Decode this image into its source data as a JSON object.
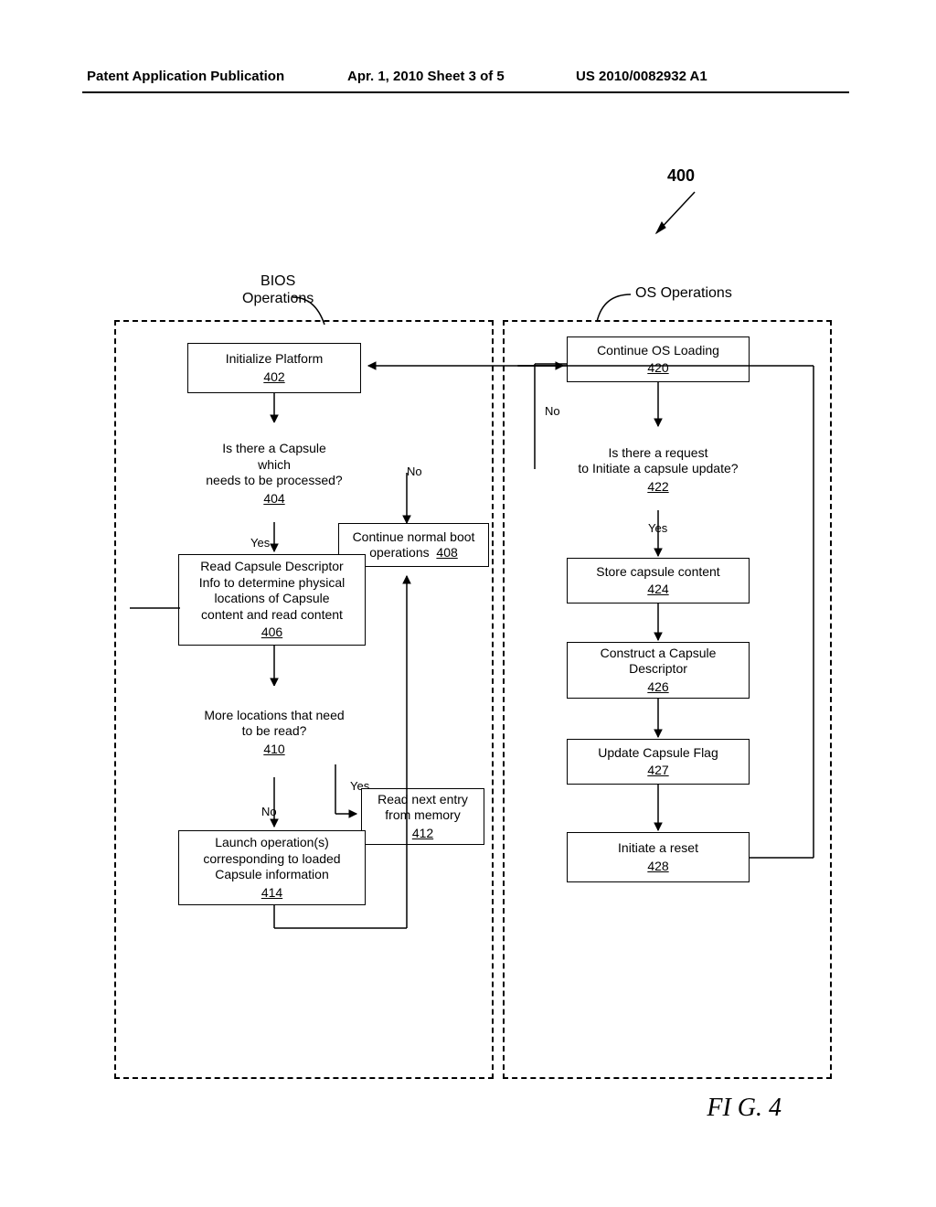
{
  "header": {
    "left": "Patent Application Publication",
    "center": "Apr. 1, 2010  Sheet 3 of 5",
    "right": "US 2010/0082932 A1"
  },
  "fig_number": "400",
  "bios_label_line1": "BIOS",
  "bios_label_line2": "Operations",
  "os_label": "OS Operations",
  "nodes": {
    "b402": {
      "text": "Initialize Platform",
      "ref": "402"
    },
    "b404": {
      "line1": "Is there a Capsule",
      "line2": "which",
      "line3": "needs to be processed?",
      "ref": "404"
    },
    "b406": {
      "line1": "Read Capsule Descriptor",
      "line2": "Info to determine physical",
      "line3": "locations of Capsule",
      "line4": "content and read content",
      "ref": "406"
    },
    "b408": {
      "line1": "Continue normal boot",
      "line2": "operations",
      "ref": "408"
    },
    "b410": {
      "line1": "More locations that need",
      "line2": "to be read?",
      "ref": "410"
    },
    "b412": {
      "line1": "Read next entry",
      "line2": "from memory",
      "ref": "412"
    },
    "b414": {
      "line1": "Launch operation(s)",
      "line2": "corresponding to loaded",
      "line3": "Capsule information",
      "ref": "414"
    },
    "b420": {
      "text": "Continue OS Loading",
      "ref": "420"
    },
    "b422": {
      "line1": "Is there a request",
      "line2": "to Initiate a capsule update?",
      "ref": "422"
    },
    "b424": {
      "text": "Store capsule content",
      "ref": "424"
    },
    "b426": {
      "line1": "Construct a Capsule",
      "line2": "Descriptor",
      "ref": "426"
    },
    "b427": {
      "text": "Update Capsule Flag",
      "ref": "427"
    },
    "b428": {
      "text": "Initiate a reset",
      "ref": "428"
    }
  },
  "labels": {
    "yes": "Yes",
    "no": "No"
  },
  "figure_label": "FI G. 4"
}
